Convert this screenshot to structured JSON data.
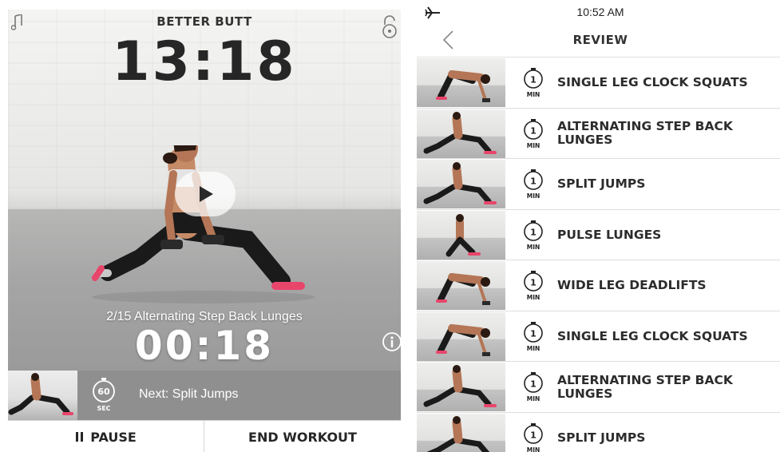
{
  "player": {
    "workout_name": "BETTER BUTT",
    "total_time": "13:18",
    "exercise_label": "2/15 Alternating Step Back Lunges",
    "exercise_time": "00:18",
    "next_timer_value": "60",
    "next_timer_unit": "SEC",
    "next_label": "Next: Split Jumps",
    "pause_label": "PAUSE",
    "end_label": "END WORKOUT",
    "icons": [
      "music-icon",
      "lock-icon",
      "play-icon",
      "info-icon",
      "stopwatch-icon",
      "pause-icon"
    ]
  },
  "review": {
    "status_time": "10:52 AM",
    "title": "REVIEW",
    "min_value": "1",
    "min_unit": "MIN",
    "icons": [
      "airplane-icon",
      "chevron-left-icon",
      "stopwatch-icon"
    ],
    "exercises": [
      {
        "name": "SINGLE LEG CLOCK SQUATS"
      },
      {
        "name": "ALTERNATING STEP BACK\nLUNGES"
      },
      {
        "name": "SPLIT JUMPS"
      },
      {
        "name": "PULSE LUNGES"
      },
      {
        "name": "WIDE LEG DEADLIFTS"
      },
      {
        "name": "SINGLE LEG CLOCK SQUATS"
      },
      {
        "name": "ALTERNATING STEP BACK\nLUNGES"
      },
      {
        "name": "SPLIT JUMPS"
      }
    ]
  },
  "colors": {
    "text_dark": "#262626",
    "bar_gray": "#8f8f8f",
    "accent_pink": "#e8456b",
    "outfit_black": "#1a1a1a"
  }
}
